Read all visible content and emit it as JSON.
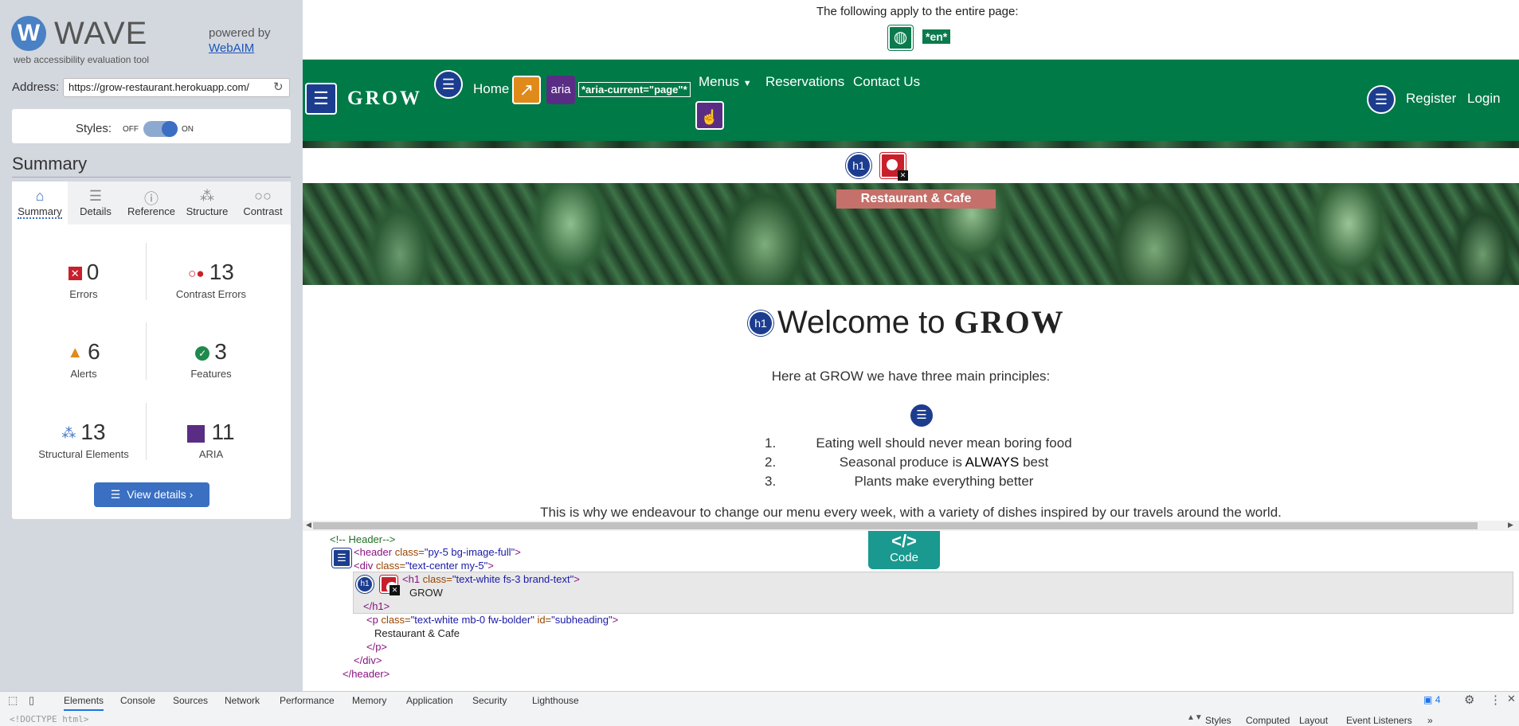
{
  "wave": {
    "logo_letter": "W",
    "logo_title": "WAVE",
    "logo_subtitle": "web accessibility evaluation tool",
    "powered_by": "powered by",
    "webaim_link": "WebAIM",
    "address_label": "Address:",
    "address_value": "https://grow-restaurant.herokuapp.com/",
    "styles_label": "Styles:",
    "styles_off": "OFF",
    "styles_on": "ON",
    "summary_title": "Summary",
    "tabs": [
      {
        "label": "Summary",
        "icon": "home-icon"
      },
      {
        "label": "Details",
        "icon": "list-icon"
      },
      {
        "label": "Reference",
        "icon": "info-icon"
      },
      {
        "label": "Structure",
        "icon": "structure-icon"
      },
      {
        "label": "Contrast",
        "icon": "contrast-icon"
      }
    ],
    "stats": [
      {
        "count": "0",
        "label": "Errors",
        "icon": "error-icon",
        "color": "#c8202b"
      },
      {
        "count": "13",
        "label": "Contrast Errors",
        "icon": "contrast-error-icon",
        "color": "#c8202b"
      },
      {
        "count": "6",
        "label": "Alerts",
        "icon": "alert-icon",
        "color": "#e08a1a"
      },
      {
        "count": "3",
        "label": "Features",
        "icon": "feature-icon",
        "color": "#1f8a4c"
      },
      {
        "count": "13",
        "label": "Structural Elements",
        "icon": "structure-icon",
        "color": "#3a6fc2"
      },
      {
        "count": "11",
        "label": "ARIA",
        "icon": "aria-icon",
        "color": "#5a2d84"
      }
    ],
    "view_details": "View details ›"
  },
  "notice": {
    "text": "The following apply to the entire page:",
    "lang_badge": "*en*"
  },
  "site": {
    "brand": "GROW",
    "nav_home": "Home",
    "aria_icon_label": "aria",
    "aria_current": "*aria-current=\"page\"*",
    "nav_menus": "Menus",
    "nav_reservations": "Reservations",
    "nav_contact": "Contact Us",
    "nav_register": "Register",
    "nav_login": "Login",
    "h1_icon_label": "h1",
    "subheading": "Restaurant & Cafe",
    "welcome_pre": "Welcome to ",
    "welcome_brand": "GROW",
    "intro": "Here at GROW we have three main principles:",
    "principles": [
      {
        "num": "1.",
        "text": "Eating well should never mean boring food"
      },
      {
        "num": "2.",
        "text_pre": "Seasonal produce is ",
        "text_bold": "ALWAYS",
        "text_post": " best"
      },
      {
        "num": "3.",
        "text": "Plants make everything better"
      }
    ],
    "why": "This is why we endeavour to change our menu every week, with a variety of dishes inspired by our travels around the world."
  },
  "code": {
    "badge_symbol": "</>",
    "badge_label": "Code",
    "lines": {
      "l1": "<!-- Header-->",
      "l2_tag": "<header ",
      "l2_attr": "class=",
      "l2_val": "\"py-5 bg-image-full\"",
      "l2_end": ">",
      "l3_tag": "<div ",
      "l3_attr": "class=",
      "l3_val": "\"text-center my-5\"",
      "l3_end": ">",
      "l4_tag": "<h1 ",
      "l4_attr": "class=",
      "l4_val": "\"text-white fs-3 brand-text\"",
      "l4_end": ">",
      "l5": "GROW",
      "l6": "</h1>",
      "l7_tag": "<p ",
      "l7_attr": "class=",
      "l7_val": "\"text-white mb-0 fw-bolder\"",
      "l7_attr2": " id=",
      "l7_val2": "\"subheading\"",
      "l7_end": ">",
      "l8": "Restaurant & Cafe",
      "l9": "</p>",
      "l10": "</div>",
      "l11": "</header>"
    }
  },
  "devtools": {
    "tabs": [
      "Elements",
      "Console",
      "Sources",
      "Network",
      "Performance",
      "Memory",
      "Application",
      "Security",
      "Lighthouse"
    ],
    "issues_count": "4",
    "doctype": "<!DOCTYPE html>",
    "right_tabs": [
      "Styles",
      "Computed",
      "Layout",
      "Event Listeners"
    ],
    "more": "»"
  }
}
